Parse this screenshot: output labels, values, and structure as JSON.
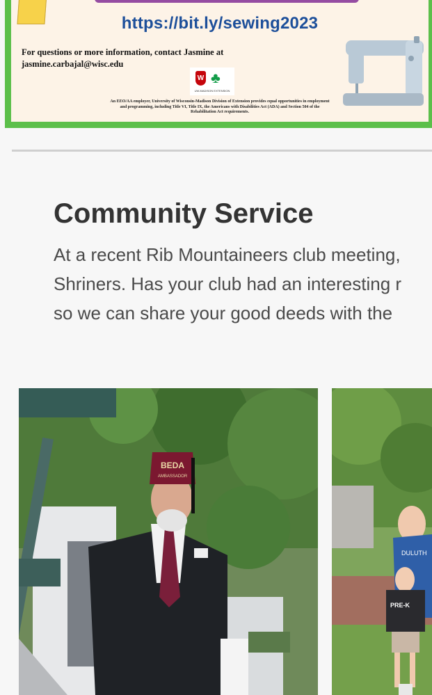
{
  "flyer": {
    "url": "https://bit.ly/sewing2023",
    "contact_line1": "For questions or more information, contact Jasmine at",
    "contact_line2": "jasmine.carbajal@wisc.edu",
    "logo_text": "UW-MADISON EXTENSION",
    "fine_print": "An EEO/AA employer, University of Wisconsin-Madison Division of Extension provides equal opportunities in employment and programming, including Title VI, Title IX, the Americans with Disabilities Act (ADA) and Section 504 of the Rehabilitation Act requirements.",
    "border_color": "#5cbf4a"
  },
  "community_service": {
    "title": "Community Service",
    "lines": [
      "At a recent Rib Mountaineers club meeting,",
      "Shriners. Has your club had an interesting r",
      "so we can share your good deeds with the"
    ]
  },
  "photos": {
    "first": {
      "hat_text": "BEDA",
      "hat_subtext": "AMBASSADOR"
    },
    "second": {
      "shirt_text": "DULUTH",
      "child_shirt_text": "PRE-K"
    }
  }
}
